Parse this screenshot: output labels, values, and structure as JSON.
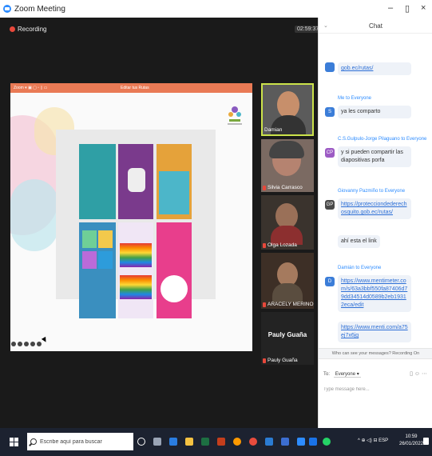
{
  "window": {
    "title": "Zoom Meeting",
    "minimize": "–",
    "restore": "▯",
    "close": "×"
  },
  "meeting": {
    "recording_label": "Recording",
    "timer": "02:59:37",
    "share_toolbar_text": "Zoom ▾  ▣  ▢  ▫  ▯  ▭",
    "share_tab_title": "Editar tus Rutas",
    "bottom_icons": [
      "mic-icon",
      "video-icon",
      "participants-icon",
      "chat-icon",
      "record-icon"
    ]
  },
  "participants": [
    {
      "name": "Damian",
      "muted": false
    },
    {
      "name": "Silvia Carrasco",
      "muted": true
    },
    {
      "name": "Olga Lozada",
      "muted": true
    },
    {
      "name": "ARACELY MERINO",
      "muted": true
    },
    {
      "name": "Pauly Guaña",
      "muted": true,
      "display": "Pauly Guaña"
    }
  ],
  "chat": {
    "title": "Chat",
    "messages": [
      {
        "sender": "",
        "avatar": "",
        "avatar_color": "#3b7dd8",
        "text": "gob.ec/rutas/",
        "link": true
      },
      {
        "sender": "Me to Everyone",
        "avatar": "S",
        "avatar_color": "#3b7dd8",
        "text": "ya les comparto",
        "link": false
      },
      {
        "sender": "C.S.Gulpulo-Jorge Pilaguano to Everyone",
        "avatar": "CP",
        "avatar_color": "#9c5bc4",
        "text": "y si pueden compartir las diapositivas porfa",
        "link": false
      },
      {
        "sender": "Giovanny Pazmiño to Everyone",
        "avatar": "GP",
        "avatar_color": "#4a4a4a",
        "text": "https://protecciondederechosquito.gob.ec/rutas/",
        "link": true
      },
      {
        "sender": "",
        "avatar": "",
        "avatar_color": "",
        "text": "ahí esta el link",
        "link": false
      },
      {
        "sender": "Damián to Everyone",
        "avatar": "D",
        "avatar_color": "#3b7dd8",
        "text": "https://www.mentimeter.com/s/63a3bbf550fa87406d79dd34514d0589b2eb19312eca/edit",
        "link": true
      },
      {
        "sender": "",
        "avatar": "",
        "avatar_color": "",
        "text": "https://www.menti.com/a75ej7x6jg",
        "link": true
      }
    ],
    "info_bar": "Who can see your messages? Recording On",
    "to_label": "To:",
    "to_value": "Everyone ▾",
    "placeholder": "Type message here..."
  },
  "taskbar": {
    "search_placeholder": "Escribe aquí para buscar",
    "tray_text": "^ ⊕ ◁) ⊟ ESP",
    "time": "10:59",
    "date": "26/01/2022"
  }
}
